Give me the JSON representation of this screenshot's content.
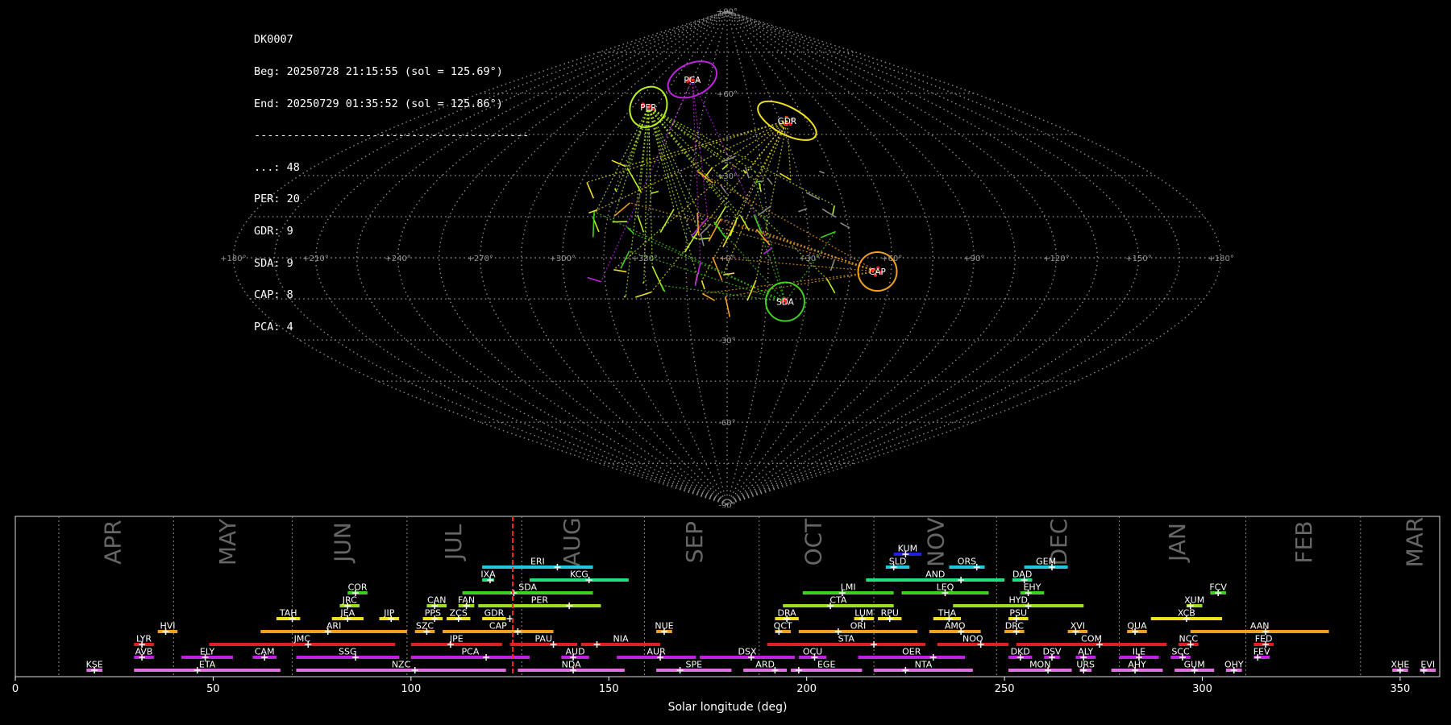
{
  "header": {
    "station": "DK0007",
    "beg": "Beg: 20250728 21:15:55 (sol = 125.69°)",
    "end": "End: 20250729 01:35:52 (sol = 125.86°)",
    "sep": "------------------------------------------",
    "counts": [
      "...: 48",
      "PER: 20",
      "GDR: 9",
      "SDA: 9",
      "CAP: 8",
      "PCA: 4"
    ]
  },
  "sky_map": {
    "lon_labels": [
      "+180°",
      "+150°",
      "+120°",
      "+90°",
      "+60°",
      "+30°",
      "+0°",
      "+330°",
      "+300°",
      "+270°",
      "+240°",
      "+210°",
      "+180°"
    ],
    "lat_labels": [
      "+90°",
      "+60°",
      "+30°",
      "-30°",
      "-60°",
      "-90°"
    ],
    "radiants": [
      {
        "name": "PCA",
        "color": "#c020e0",
        "lon": 30,
        "lat": 65
      },
      {
        "name": "PER",
        "color": "#b8f020",
        "lon": 50,
        "lat": 55
      },
      {
        "name": "GDR",
        "color": "#f0e020",
        "lon": 326,
        "lat": 50
      },
      {
        "name": "CAP",
        "color": "#f0a020",
        "lon": 305,
        "lat": -5
      },
      {
        "name": "SDA",
        "color": "#40d020",
        "lon": 338,
        "lat": -16
      }
    ]
  },
  "chart_data": {
    "type": "timeline",
    "xlabel": "Solar longitude (deg)",
    "xlim": [
      0,
      360
    ],
    "xticks": [
      0,
      50,
      100,
      150,
      200,
      250,
      300,
      350
    ],
    "current_sol": 125.7,
    "month_boundaries": [
      11,
      40,
      70,
      99,
      128,
      159,
      188,
      217,
      248,
      279,
      311,
      340
    ],
    "months": [
      {
        "label": "APR",
        "pos": 25
      },
      {
        "label": "MAY",
        "pos": 54
      },
      {
        "label": "JUN",
        "pos": 83
      },
      {
        "label": "JUL",
        "pos": 111
      },
      {
        "label": "AUG",
        "pos": 141
      },
      {
        "label": "SEP",
        "pos": 172
      },
      {
        "label": "OCT",
        "pos": 202
      },
      {
        "label": "NOV",
        "pos": 233
      },
      {
        "label": "DEC",
        "pos": 264
      },
      {
        "label": "JAN",
        "pos": 294
      },
      {
        "label": "FEB",
        "pos": 326
      },
      {
        "label": "MAR",
        "pos": 354
      }
    ],
    "showers": [
      {
        "code": "KUM",
        "start": 222,
        "end": 229,
        "peak": 225,
        "row": 9,
        "color": "#2020e0"
      },
      {
        "code": "ERI",
        "start": 118,
        "end": 146,
        "peak": 137,
        "row": 8,
        "color": "#20c8e0"
      },
      {
        "code": "SLD",
        "start": 220,
        "end": 226,
        "peak": 222,
        "row": 8,
        "color": "#20c8e0"
      },
      {
        "code": "ORS",
        "start": 236,
        "end": 245,
        "peak": 243,
        "row": 8,
        "color": "#20c8e0"
      },
      {
        "code": "GEM",
        "start": 255,
        "end": 266,
        "peak": 262,
        "row": 8,
        "color": "#20c8e0"
      },
      {
        "code": "IXA",
        "start": 118,
        "end": 121,
        "peak": 120,
        "row": 7,
        "color": "#20e080"
      },
      {
        "code": "KCG",
        "start": 130,
        "end": 155,
        "peak": 145,
        "row": 7,
        "color": "#20e080"
      },
      {
        "code": "AND",
        "start": 215,
        "end": 250,
        "peak": 239,
        "row": 7,
        "color": "#20e080"
      },
      {
        "code": "DAD",
        "start": 252,
        "end": 257,
        "peak": 255,
        "row": 7,
        "color": "#20e080"
      },
      {
        "code": "COR",
        "start": 84,
        "end": 89,
        "peak": 86,
        "row": 6,
        "color": "#40d020"
      },
      {
        "code": "SDA",
        "start": 113,
        "end": 146,
        "peak": 126,
        "row": 6,
        "color": "#40d020"
      },
      {
        "code": "LMI",
        "start": 199,
        "end": 222,
        "peak": 209,
        "row": 6,
        "color": "#40d020"
      },
      {
        "code": "LEQ",
        "start": 224,
        "end": 246,
        "peak": 235,
        "row": 6,
        "color": "#40d020"
      },
      {
        "code": "EHY",
        "start": 254,
        "end": 260,
        "peak": 256,
        "row": 6,
        "color": "#40d020"
      },
      {
        "code": "FCV",
        "start": 302,
        "end": 306,
        "peak": 304,
        "row": 6,
        "color": "#40d020"
      },
      {
        "code": "JRC",
        "start": 82,
        "end": 87,
        "peak": 84,
        "row": 5,
        "color": "#a0e020"
      },
      {
        "code": "CAN",
        "start": 104,
        "end": 109,
        "peak": 106,
        "row": 5,
        "color": "#a0e020"
      },
      {
        "code": "FAN",
        "start": 112,
        "end": 116,
        "peak": 114,
        "row": 5,
        "color": "#a0e020"
      },
      {
        "code": "PER",
        "start": 117,
        "end": 148,
        "peak": 140,
        "row": 5,
        "color": "#a0e020"
      },
      {
        "code": "CTA",
        "start": 194,
        "end": 222,
        "peak": 206,
        "row": 5,
        "color": "#a0e020"
      },
      {
        "code": "HYD",
        "start": 237,
        "end": 270,
        "peak": 256,
        "row": 5,
        "color": "#a0e020"
      },
      {
        "code": "XUM",
        "start": 296,
        "end": 300,
        "peak": 297,
        "row": 5,
        "color": "#a0e020"
      },
      {
        "code": "TAH",
        "start": 66,
        "end": 72,
        "peak": 70,
        "row": 4,
        "color": "#f0e020"
      },
      {
        "code": "JEA",
        "start": 80,
        "end": 88,
        "peak": 84,
        "row": 4,
        "color": "#f0e020"
      },
      {
        "code": "JIP",
        "start": 92,
        "end": 97,
        "peak": 95,
        "row": 4,
        "color": "#f0e020"
      },
      {
        "code": "PPS",
        "start": 103,
        "end": 108,
        "peak": 106,
        "row": 4,
        "color": "#f0e020"
      },
      {
        "code": "ZCS",
        "start": 109,
        "end": 115,
        "peak": 112,
        "row": 4,
        "color": "#f0e020"
      },
      {
        "code": "GDR",
        "start": 118,
        "end": 124,
        "peak": 125,
        "row": 4,
        "color": "#f0e020"
      },
      {
        "code": "DRA",
        "start": 192,
        "end": 198,
        "peak": 195,
        "row": 4,
        "color": "#f0e020"
      },
      {
        "code": "LUM",
        "start": 212,
        "end": 217,
        "peak": 214,
        "row": 4,
        "color": "#f0e020"
      },
      {
        "code": "RPU",
        "start": 218,
        "end": 224,
        "peak": 221,
        "row": 4,
        "color": "#f0e020"
      },
      {
        "code": "THA",
        "start": 232,
        "end": 239,
        "peak": 236,
        "row": 4,
        "color": "#f0e020"
      },
      {
        "code": "PSU",
        "start": 251,
        "end": 256,
        "peak": 253,
        "row": 4,
        "color": "#f0e020"
      },
      {
        "code": "XCB",
        "start": 287,
        "end": 305,
        "peak": 296,
        "row": 4,
        "color": "#f0e020"
      },
      {
        "code": "HVI",
        "start": 36,
        "end": 41,
        "peak": 38,
        "row": 3,
        "color": "#f0a020"
      },
      {
        "code": "ARI",
        "start": 62,
        "end": 99,
        "peak": 79,
        "row": 3,
        "color": "#f0a020"
      },
      {
        "code": "SZC",
        "start": 101,
        "end": 106,
        "peak": 104,
        "row": 3,
        "color": "#f0a020"
      },
      {
        "code": "CAP",
        "start": 108,
        "end": 136,
        "peak": 127,
        "row": 3,
        "color": "#f0a020"
      },
      {
        "code": "NUE",
        "start": 162,
        "end": 166,
        "peak": 164,
        "row": 3,
        "color": "#f0a020"
      },
      {
        "code": "OCT",
        "start": 192,
        "end": 196,
        "peak": 193,
        "row": 3,
        "color": "#f0a020"
      },
      {
        "code": "ORI",
        "start": 198,
        "end": 228,
        "peak": 208,
        "row": 3,
        "color": "#f0a020"
      },
      {
        "code": "AMO",
        "start": 231,
        "end": 244,
        "peak": 239,
        "row": 3,
        "color": "#f0a020"
      },
      {
        "code": "DRC",
        "start": 250,
        "end": 255,
        "peak": 253,
        "row": 3,
        "color": "#f0a020"
      },
      {
        "code": "XVI",
        "start": 266,
        "end": 271,
        "peak": 268,
        "row": 3,
        "color": "#f0a020"
      },
      {
        "code": "QUA",
        "start": 281,
        "end": 286,
        "peak": 283,
        "row": 3,
        "color": "#f0a020"
      },
      {
        "code": "AAN",
        "start": 297,
        "end": 332,
        "peak": 316,
        "row": 3,
        "color": "#f0a020"
      },
      {
        "code": "LYR",
        "start": 30,
        "end": 35,
        "peak": 32,
        "row": 2,
        "color": "#e02020"
      },
      {
        "code": "JMC",
        "start": 49,
        "end": 96,
        "peak": 74,
        "row": 2,
        "color": "#e02020"
      },
      {
        "code": "JPE",
        "start": 100,
        "end": 123,
        "peak": 110,
        "row": 2,
        "color": "#e02020"
      },
      {
        "code": "PAU",
        "start": 125,
        "end": 142,
        "peak": 136,
        "row": 2,
        "color": "#e02020"
      },
      {
        "code": "NIA",
        "start": 143,
        "end": 163,
        "peak": 147,
        "row": 2,
        "color": "#e02020"
      },
      {
        "code": "STA",
        "start": 190,
        "end": 230,
        "peak": 217,
        "row": 2,
        "color": "#e02020"
      },
      {
        "code": "NOO",
        "start": 233,
        "end": 251,
        "peak": 244,
        "row": 2,
        "color": "#e02020"
      },
      {
        "code": "COM",
        "start": 253,
        "end": 291,
        "peak": 274,
        "row": 2,
        "color": "#e02020"
      },
      {
        "code": "NCC",
        "start": 294,
        "end": 299,
        "peak": 297,
        "row": 2,
        "color": "#e02020"
      },
      {
        "code": "FED",
        "start": 313,
        "end": 318,
        "peak": 316,
        "row": 2,
        "color": "#e02020"
      },
      {
        "code": "AVB",
        "start": 30,
        "end": 35,
        "peak": 32,
        "row": 1,
        "color": "#c020e0"
      },
      {
        "code": "ELY",
        "start": 42,
        "end": 55,
        "peak": 48,
        "row": 1,
        "color": "#c020e0"
      },
      {
        "code": "CAM",
        "start": 60,
        "end": 66,
        "peak": 63,
        "row": 1,
        "color": "#c020e0"
      },
      {
        "code": "SSG",
        "start": 71,
        "end": 97,
        "peak": 86,
        "row": 1,
        "color": "#c020e0"
      },
      {
        "code": "PCA",
        "start": 100,
        "end": 130,
        "peak": 119,
        "row": 1,
        "color": "#c020e0"
      },
      {
        "code": "AUD",
        "start": 138,
        "end": 145,
        "peak": 141,
        "row": 1,
        "color": "#c020e0"
      },
      {
        "code": "AUR",
        "start": 152,
        "end": 172,
        "peak": 163,
        "row": 1,
        "color": "#c020e0"
      },
      {
        "code": "DSX",
        "start": 173,
        "end": 197,
        "peak": 186,
        "row": 1,
        "color": "#c020e0"
      },
      {
        "code": "OCU",
        "start": 198,
        "end": 205,
        "peak": 202,
        "row": 1,
        "color": "#c020e0"
      },
      {
        "code": "OER",
        "start": 213,
        "end": 240,
        "peak": 232,
        "row": 1,
        "color": "#c020e0"
      },
      {
        "code": "DKD",
        "start": 251,
        "end": 257,
        "peak": 254,
        "row": 1,
        "color": "#c020e0"
      },
      {
        "code": "DSV",
        "start": 260,
        "end": 264,
        "peak": 262,
        "row": 1,
        "color": "#c020e0"
      },
      {
        "code": "ALY",
        "start": 268,
        "end": 273,
        "peak": 270,
        "row": 1,
        "color": "#c020e0"
      },
      {
        "code": "ILE",
        "start": 279,
        "end": 289,
        "peak": 284,
        "row": 1,
        "color": "#c020e0"
      },
      {
        "code": "SCC",
        "start": 292,
        "end": 297,
        "peak": 295,
        "row": 1,
        "color": "#c020e0"
      },
      {
        "code": "FEV",
        "start": 313,
        "end": 317,
        "peak": 314,
        "row": 1,
        "color": "#c020e0"
      },
      {
        "code": "KSE",
        "start": 18,
        "end": 22,
        "peak": 20,
        "row": 0,
        "color": "#e070e0"
      },
      {
        "code": "ETA",
        "start": 30,
        "end": 67,
        "peak": 46,
        "row": 0,
        "color": "#e070e0"
      },
      {
        "code": "NZC",
        "start": 71,
        "end": 124,
        "peak": 101,
        "row": 0,
        "color": "#e070e0"
      },
      {
        "code": "NDA",
        "start": 127,
        "end": 154,
        "peak": 141,
        "row": 0,
        "color": "#e070e0"
      },
      {
        "code": "SPE",
        "start": 162,
        "end": 181,
        "peak": 168,
        "row": 0,
        "color": "#e070e0"
      },
      {
        "code": "ARD",
        "start": 184,
        "end": 195,
        "peak": 192,
        "row": 0,
        "color": "#e070e0"
      },
      {
        "code": "EGE",
        "start": 196,
        "end": 214,
        "peak": 198,
        "row": 0,
        "color": "#e070e0"
      },
      {
        "code": "NTA",
        "start": 217,
        "end": 242,
        "peak": 225,
        "row": 0,
        "color": "#e070e0"
      },
      {
        "code": "MON",
        "start": 251,
        "end": 267,
        "peak": 261,
        "row": 0,
        "color": "#e070e0"
      },
      {
        "code": "URS",
        "start": 269,
        "end": 272,
        "peak": 270,
        "row": 0,
        "color": "#e070e0"
      },
      {
        "code": "AHY",
        "start": 277,
        "end": 290,
        "peak": 283,
        "row": 0,
        "color": "#e070e0"
      },
      {
        "code": "GUM",
        "start": 293,
        "end": 303,
        "peak": 298,
        "row": 0,
        "color": "#e070e0"
      },
      {
        "code": "OHY",
        "start": 306,
        "end": 310,
        "peak": 308,
        "row": 0,
        "color": "#e070e0"
      },
      {
        "code": "XHE",
        "start": 348,
        "end": 352,
        "peak": 350,
        "row": 0,
        "color": "#e070e0"
      },
      {
        "code": "EVI",
        "start": 355,
        "end": 359,
        "peak": 356,
        "row": 0,
        "color": "#e070e0"
      }
    ]
  }
}
